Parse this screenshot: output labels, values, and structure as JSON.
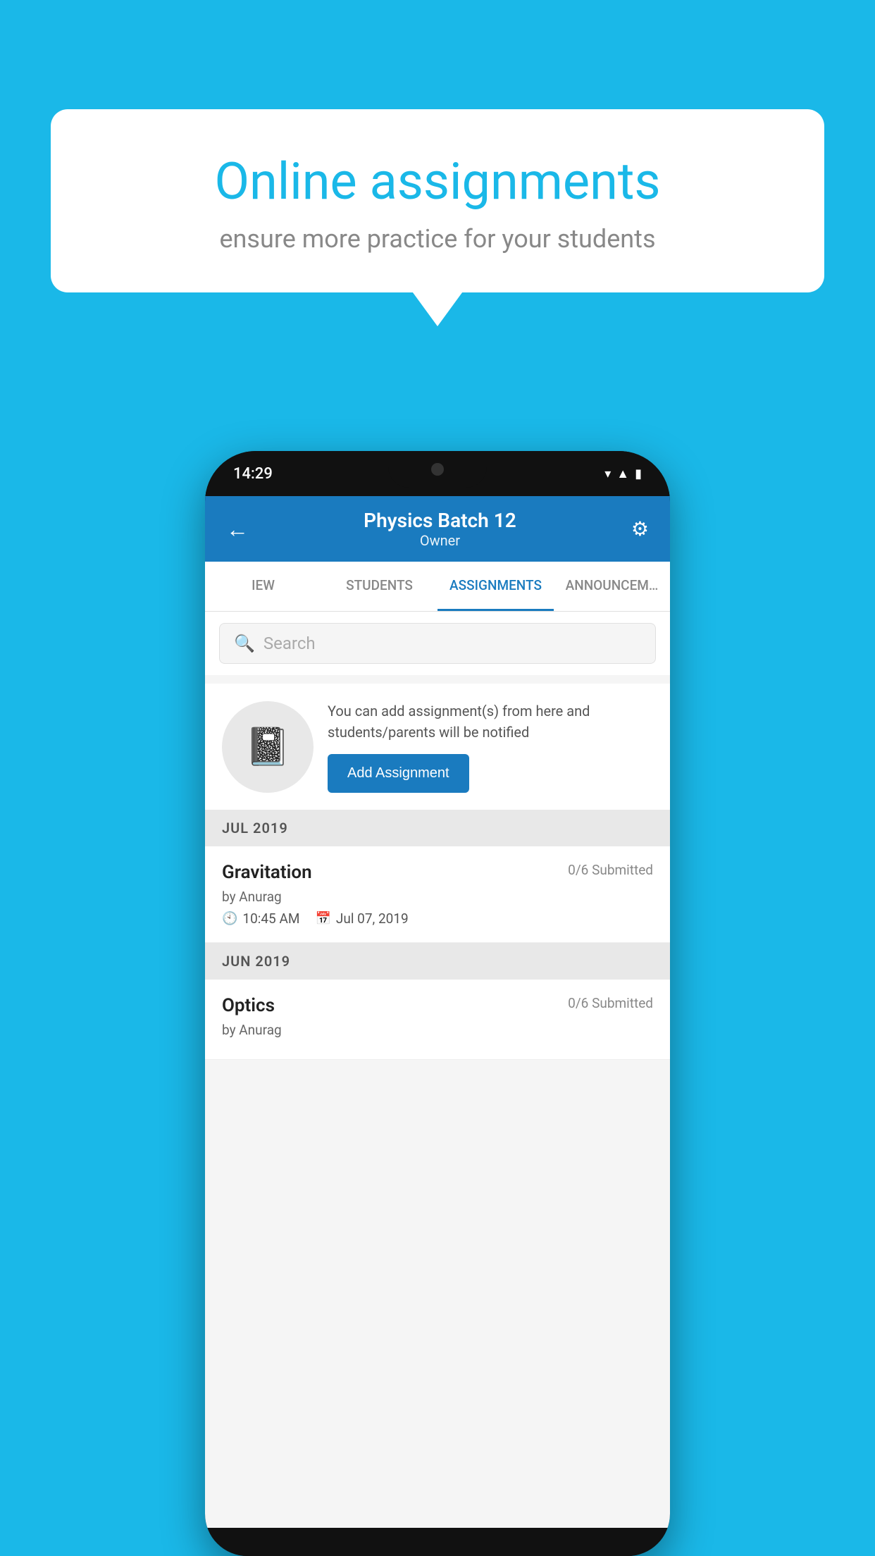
{
  "background_color": "#1ab8e8",
  "speech_bubble": {
    "title": "Online assignments",
    "subtitle": "ensure more practice for your students"
  },
  "phone": {
    "status_bar": {
      "time": "14:29",
      "icons": [
        "wifi",
        "signal",
        "battery"
      ]
    },
    "header": {
      "title": "Physics Batch 12",
      "subtitle": "Owner",
      "back_label": "←",
      "settings_label": "⚙"
    },
    "tabs": [
      {
        "label": "IEW",
        "active": false
      },
      {
        "label": "STUDENTS",
        "active": false
      },
      {
        "label": "ASSIGNMENTS",
        "active": true
      },
      {
        "label": "ANNOUNCEM…",
        "active": false
      }
    ],
    "search": {
      "placeholder": "Search"
    },
    "promo": {
      "description": "You can add assignment(s) from here and students/parents will be notified",
      "button_label": "Add Assignment"
    },
    "assignment_groups": [
      {
        "month_label": "JUL 2019",
        "assignments": [
          {
            "name": "Gravitation",
            "submitted": "0/6 Submitted",
            "author": "by Anurag",
            "time": "10:45 AM",
            "date": "Jul 07, 2019"
          }
        ]
      },
      {
        "month_label": "JUN 2019",
        "assignments": [
          {
            "name": "Optics",
            "submitted": "0/6 Submitted",
            "author": "by Anurag",
            "time": "",
            "date": ""
          }
        ]
      }
    ]
  }
}
